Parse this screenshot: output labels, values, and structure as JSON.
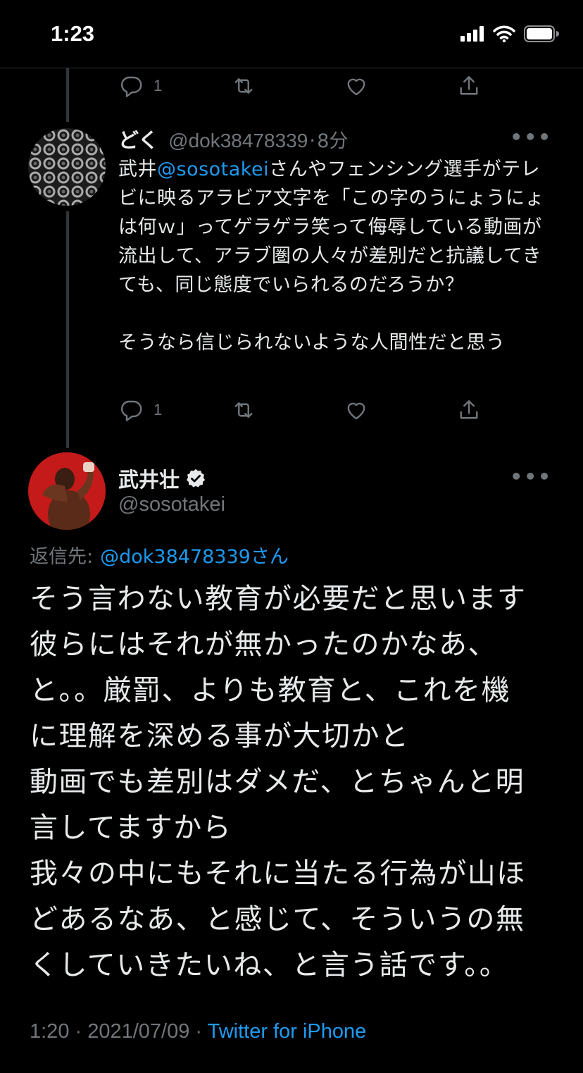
{
  "status_bar": {
    "time": "1:23"
  },
  "prev_tweet_actions": {
    "reply_count": "1"
  },
  "reply_tweet": {
    "display_name": "どく",
    "handle": "@dok38478339",
    "separator": "·",
    "time_ago": "8分",
    "text_before_mention": "武井",
    "mention": "@sosotakei",
    "text_after_mention": "さんやフェンシング選手がテレビに映るアラビア文字を「この字のうにょうにょは何ｗ」ってゲラゲラ笑って侮辱している動画が流出して、アラブ圏の人々が差別だと抗議してきても、同じ態度でいられるのだろうか？\n\nそうなら信じられないような人間性だと思う",
    "actions": {
      "reply_count": "1"
    }
  },
  "main_tweet": {
    "display_name": "武井壮",
    "handle": "@sosotakei",
    "reply_to_label": "返信先: ",
    "reply_to_handle": "@dok38478339さん",
    "text": "そう言わない教育が必要だと思います\n彼らにはそれが無かったのかなあ、\nと。。厳罰、よりも教育と、これを機\nに理解を深める事が大切かと\n動画でも差別はダメだ、とちゃんと明\n言してますから\n我々の中にもそれに当たる行為が山ほ\nどあるなあ、と感じて、そういうの無\nくしていきたいね、と言う話です。。",
    "timestamp": "1:20 · 2021/07/09 · ",
    "source": "Twitter for iPhone"
  },
  "colors": {
    "accent": "#1d9bf0",
    "muted": "#71767b",
    "text": "#e7e9ea"
  }
}
